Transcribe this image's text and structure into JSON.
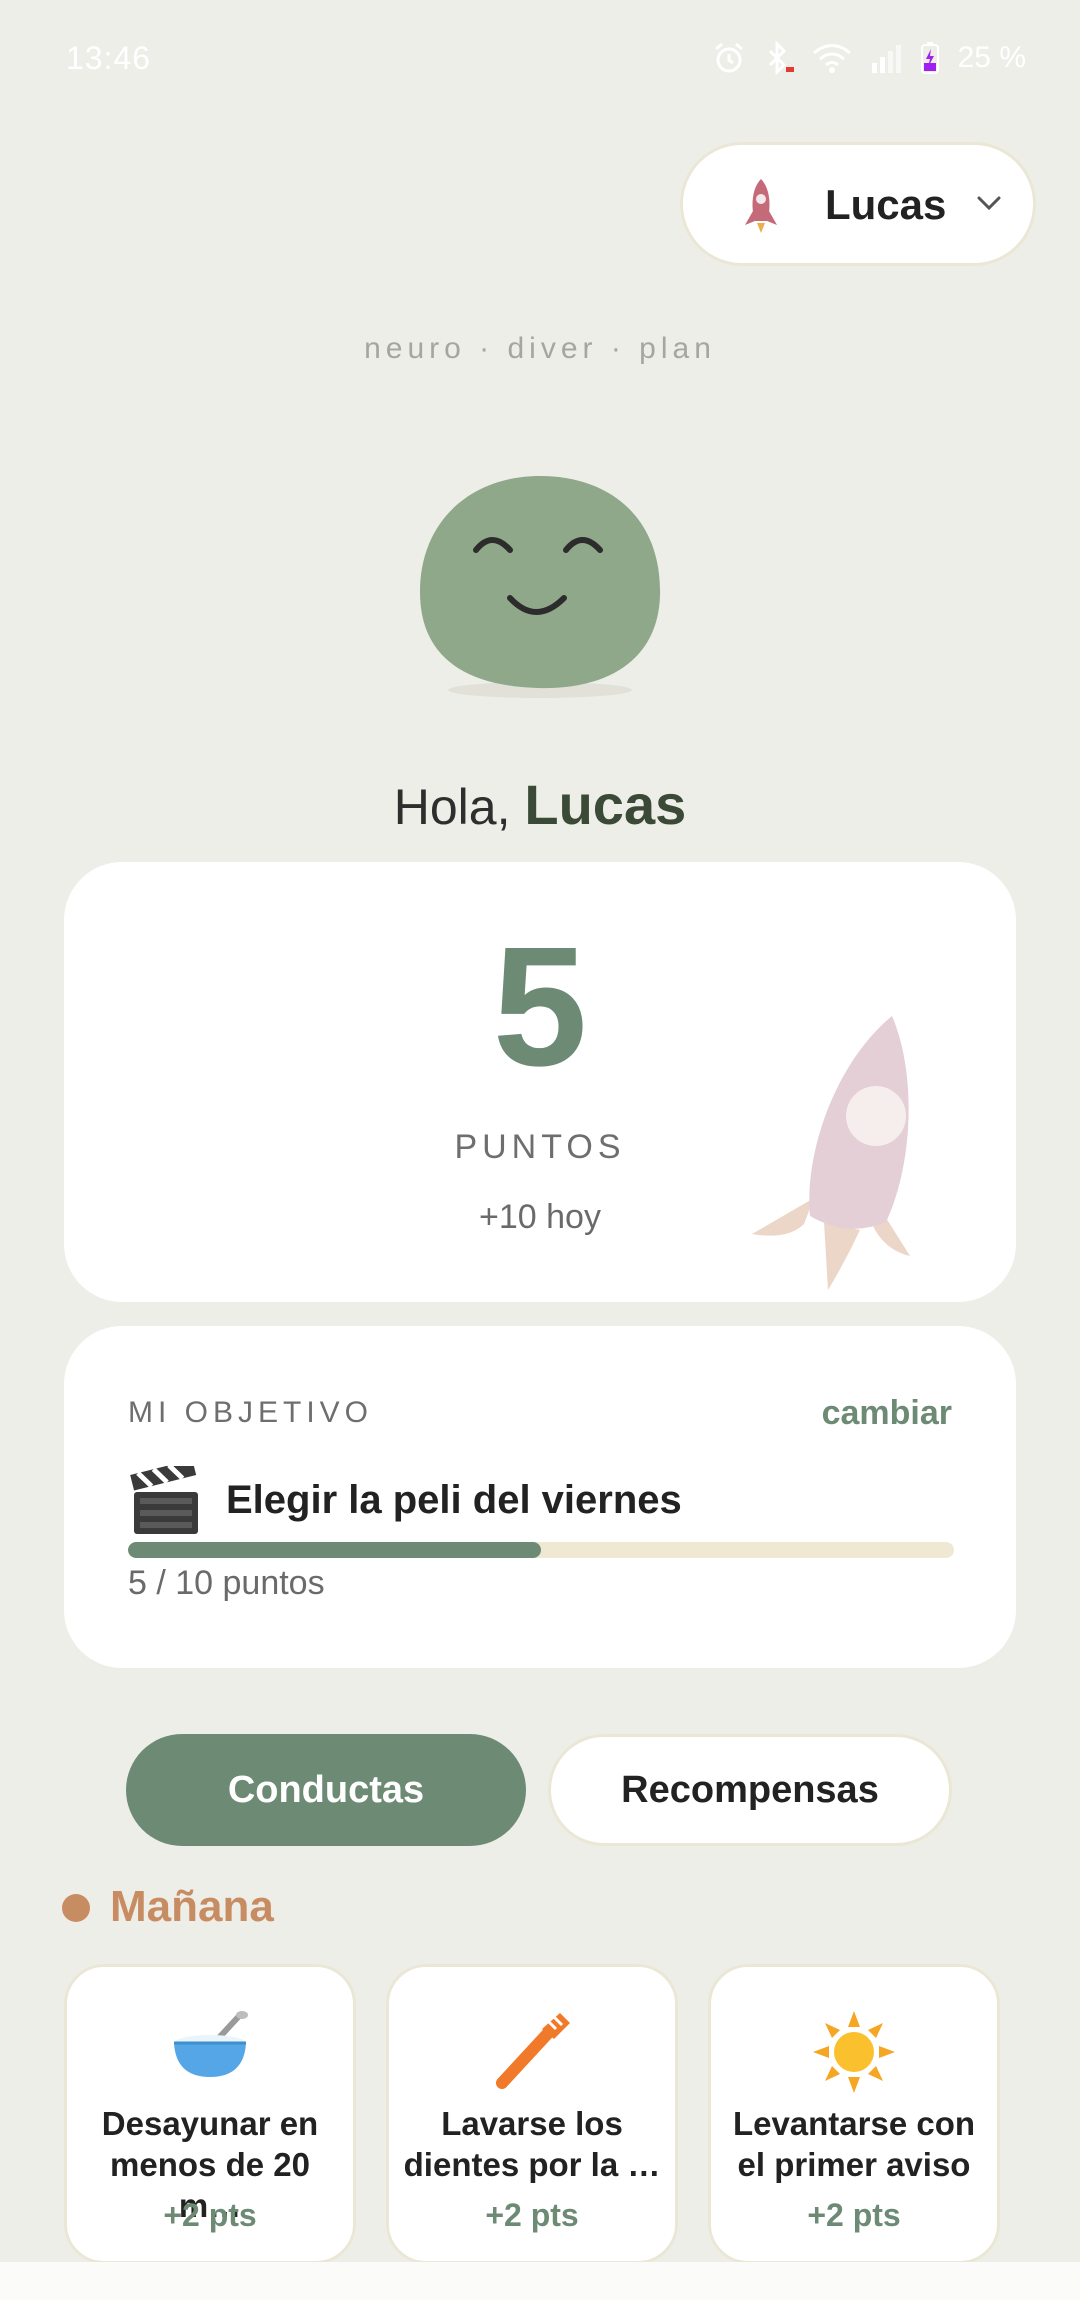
{
  "status_bar": {
    "time": "13:46",
    "battery": "25 %",
    "icons": [
      "alarm-icon",
      "bluetooth-icon",
      "wifi-icon",
      "signal-icon",
      "battery-icon"
    ]
  },
  "profile": {
    "name": "Lucas",
    "icon": "rocket-icon"
  },
  "brand": "neuro · diver · plan",
  "greeting": {
    "prefix": "Hola,",
    "name": "Lucas"
  },
  "points": {
    "value": "5",
    "label": "PUNTOS",
    "today": "+10 hoy"
  },
  "goal": {
    "label": "MI OBJETIVO",
    "change_label": "cambiar",
    "emoji": "clapperboard-icon",
    "title": "Elegir la peli del viernes",
    "progress_text": "5 / 10 puntos",
    "progress_fraction": 0.5
  },
  "tabs": [
    {
      "label": "Conductas",
      "active": true
    },
    {
      "label": "Recompensas",
      "active": false
    }
  ],
  "section": {
    "title": "Mañana",
    "color": "#c88c62"
  },
  "behaviors": [
    {
      "icon": "bowl-icon",
      "label": "Desayunar en menos de 20 m…",
      "points": "+2 pts"
    },
    {
      "icon": "toothbrush-icon",
      "label": "Lavarse los dientes por la …",
      "points": "+2 pts"
    },
    {
      "icon": "sun-icon",
      "label": "Levantarse con el primer aviso",
      "points": "+2 pts"
    }
  ],
  "colors": {
    "accent": "#6c8a74",
    "background": "#eeeee8",
    "section": "#c88c62"
  }
}
